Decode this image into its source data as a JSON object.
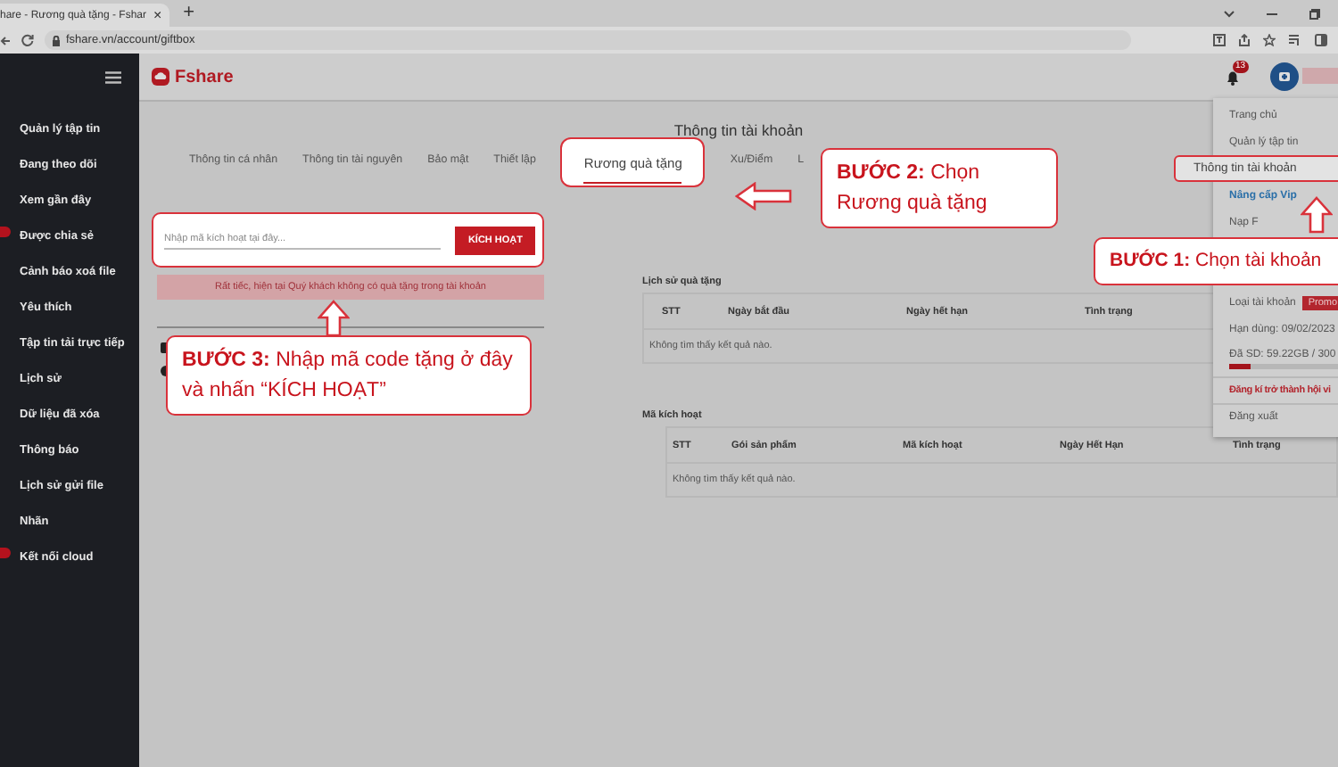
{
  "browser": {
    "tab_title": "hare - Rương quà tặng - Fshar",
    "tab_close": "×",
    "new_tab": "+",
    "url": "fshare.vn/account/giftbox"
  },
  "sidebar": {
    "items": [
      {
        "label": "Quản lý tập tin",
        "badge": false
      },
      {
        "label": "Đang theo dõi",
        "badge": false
      },
      {
        "label": "Xem gần đây",
        "badge": false
      },
      {
        "label": "Được chia sẻ",
        "badge": true
      },
      {
        "label": "Cảnh báo xoá file",
        "badge": false
      },
      {
        "label": "Yêu thích",
        "badge": false
      },
      {
        "label": "Tập tin tải trực tiếp",
        "badge": false
      },
      {
        "label": "Lịch sử",
        "badge": false
      },
      {
        "label": "Dữ liệu đã xóa",
        "badge": false
      },
      {
        "label": "Thông báo",
        "badge": false
      },
      {
        "label": "Lịch sử gửi file",
        "badge": false
      },
      {
        "label": "Nhãn",
        "badge": false
      },
      {
        "label": "Kết nối cloud",
        "badge": true
      }
    ]
  },
  "header": {
    "logo": "Fshare",
    "notification_count": "13"
  },
  "page": {
    "title": "Thông tin tài khoản",
    "tabs": [
      {
        "label": "Thông tin cá nhân",
        "selected": false
      },
      {
        "label": "Thông tin tài nguyên",
        "selected": false
      },
      {
        "label": "Bảo mật",
        "selected": false
      },
      {
        "label": "Thiết lập",
        "selected": false
      },
      {
        "label": "Rương quà tặng",
        "selected": true
      },
      {
        "label": "Xu/Điểm",
        "selected": false
      },
      {
        "label": "L",
        "selected": false
      }
    ],
    "code_field": {
      "placeholder": "Nhập mã kích hoạt tại đây..."
    },
    "activate_button": "KÍCH HOẠT",
    "alert": "Rất tiếc, hiện tại Quý khách không có quà tặng trong tài khoản",
    "gift_history": {
      "title": "Lịch sử quà tặng",
      "columns": [
        "STT",
        "Ngày bắt đầu",
        "Ngày hết hạn",
        "Tình trạng"
      ],
      "empty_message": "Không tìm thấy kết quả nào."
    },
    "activation_codes": {
      "title": "Mã kích hoạt",
      "columns": [
        "STT",
        "Gói sản phẩm",
        "Mã kích hoạt",
        "Ngày Hết Hạn",
        "Tình trạng"
      ],
      "empty_message": "Không tìm thấy kết quả nào."
    }
  },
  "user_menu": {
    "items": [
      {
        "kind": "link",
        "label": "Trang chủ",
        "highlighted": false
      },
      {
        "kind": "link",
        "label": "Quản lý tập tin",
        "highlighted": false
      },
      {
        "kind": "link",
        "label": "Thông tin tài khoản",
        "highlighted": true
      },
      {
        "kind": "upgrade",
        "label": "Nâng cấp Vip",
        "highlighted": false
      },
      {
        "kind": "link",
        "label": "Nạp F",
        "highlighted": false
      },
      {
        "kind": "account_type",
        "label": "Loại tài khoản",
        "badge": "Promo",
        "highlighted": false
      },
      {
        "kind": "text",
        "label": "Hạn dùng: 09/02/2023",
        "highlighted": false
      },
      {
        "kind": "usage",
        "label": "Đã SD: 59.22GB / 300",
        "level": 0.2,
        "highlighted": false
      },
      {
        "kind": "register",
        "label": "Đăng kí trở thành hội vi",
        "highlighted": false
      },
      {
        "kind": "link",
        "label": "Đăng xuất",
        "highlighted": false
      }
    ]
  },
  "callouts": [
    {
      "text": "**BƯỚC 1:** Chọn tài khoản"
    },
    {
      "text": "**BƯỚC 2:** Chọn Rương quà tặng"
    },
    {
      "text": "**BƯỚC 3:** Nhập mã code tặng ở đây và nhấn “KÍCH HOẠT”"
    }
  ]
}
